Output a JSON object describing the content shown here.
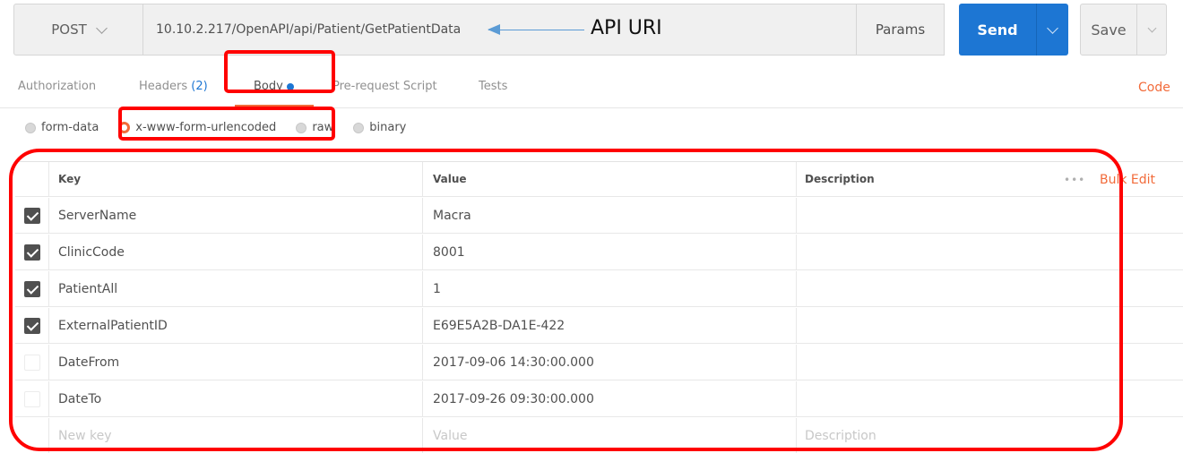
{
  "request": {
    "method": "POST",
    "url": "10.10.2.217/OpenAPI/api/Patient/GetPatientData",
    "params_label": "Params",
    "send_label": "Send",
    "save_label": "Save"
  },
  "annotation": {
    "api_uri_label": "API URI"
  },
  "tabs": [
    {
      "label": "Authorization"
    },
    {
      "label": "Headers",
      "badge": "(2)"
    },
    {
      "label": "Body"
    },
    {
      "label": "Pre-request Script"
    },
    {
      "label": "Tests"
    }
  ],
  "code_label": "Code",
  "body_modes": [
    {
      "label": "form-data",
      "selected": false
    },
    {
      "label": "x-www-form-urlencoded",
      "selected": true
    },
    {
      "label": "raw",
      "selected": false
    },
    {
      "label": "binary",
      "selected": false
    }
  ],
  "table": {
    "headers": {
      "key": "Key",
      "value": "Value",
      "description": "Description"
    },
    "more_label": "•••",
    "bulk_edit_label": "Bulk Edit",
    "rows": [
      {
        "checked": true,
        "key": "ServerName",
        "value": "Macra"
      },
      {
        "checked": true,
        "key": "ClinicCode",
        "value": "8001"
      },
      {
        "checked": true,
        "key": "PatientAll",
        "value": "1"
      },
      {
        "checked": true,
        "key": "ExternalPatientID",
        "value": "E69E5A2B-DA1E-422"
      },
      {
        "checked": false,
        "key": "DateFrom",
        "value": "2017-09-06 14:30:00.000"
      },
      {
        "checked": false,
        "key": "DateTo",
        "value": "2017-09-26 09:30:00.000"
      }
    ],
    "new_row": {
      "key": "New key",
      "value": "Value",
      "description": "Description"
    }
  },
  "colors": {
    "accent": "#f26b3a",
    "send": "#1d76d3",
    "annotation_red": "#ff0000",
    "annotation_arrow": "#5b9bd5"
  }
}
